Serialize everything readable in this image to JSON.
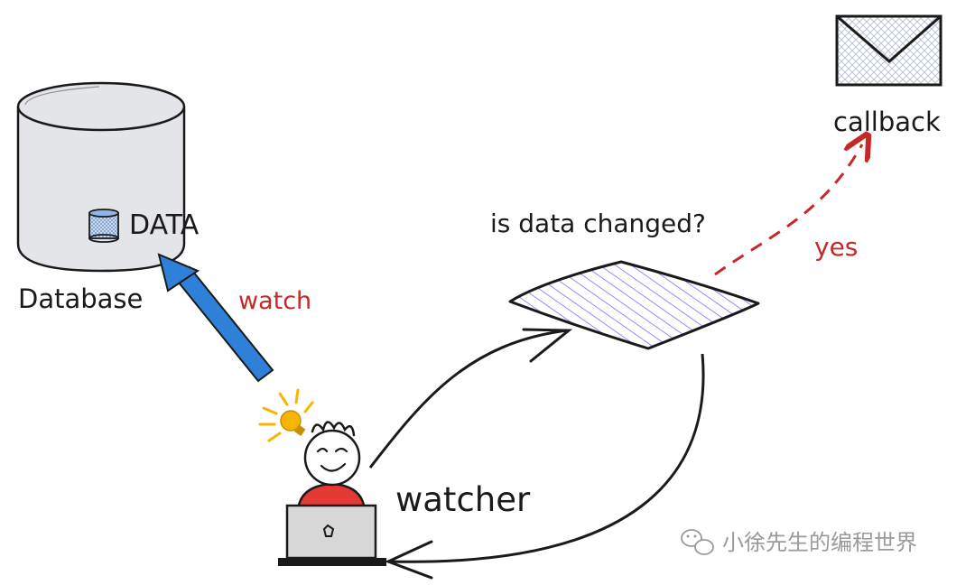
{
  "labels": {
    "data": "DATA",
    "database": "Database",
    "watch": "watch",
    "question": "is data changed?",
    "yes": "yes",
    "callback": "callback",
    "watcher": "watcher"
  },
  "watermark": {
    "text": "小徐先生的编程世界",
    "icon": "wechat-icon"
  },
  "colors": {
    "ink": "#1a1a1a",
    "database_fill": "#e4e5e8",
    "watch_arrow": "#2f80d8",
    "accent_red": "#c62828",
    "diamond_hatch": "#7b61ff",
    "bulb": "#f7b500",
    "shirt": "#e53935",
    "laptop": "#d7d7d7",
    "envelope_hatch": "#b9c4d6",
    "mini_db": "#8fb6e6"
  }
}
